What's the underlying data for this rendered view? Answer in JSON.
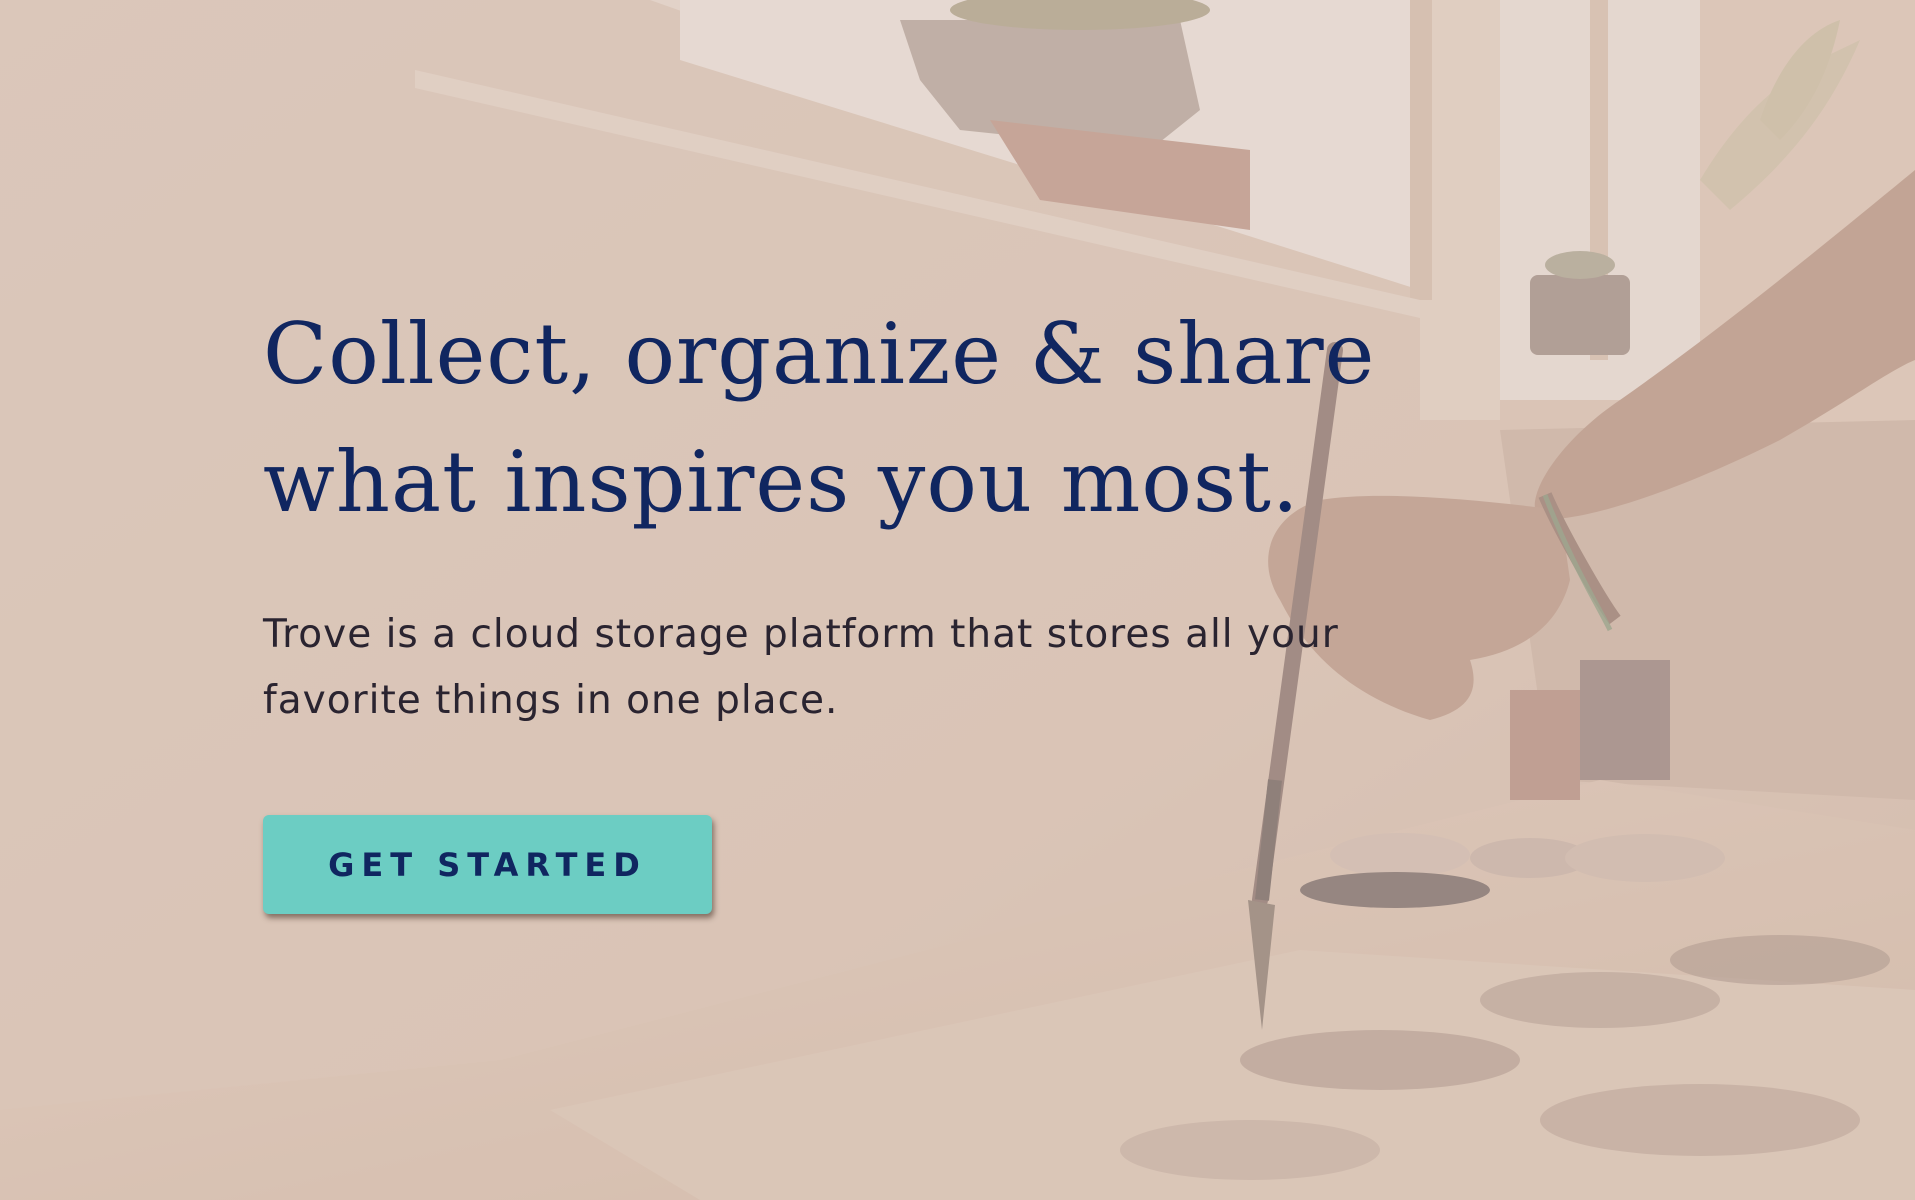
{
  "hero": {
    "headline_line1": "Collect, organize & share",
    "headline_line2": "what inspires you most.",
    "description": "Trove is a cloud storage platform that stores all your favorite things in one place.",
    "cta_label": "GET STARTED"
  },
  "colors": {
    "headline": "#102660",
    "body_text": "#2a2430",
    "cta_background": "#6ccdc3",
    "cta_text": "#102660",
    "overlay_tint": "#decbbe"
  }
}
